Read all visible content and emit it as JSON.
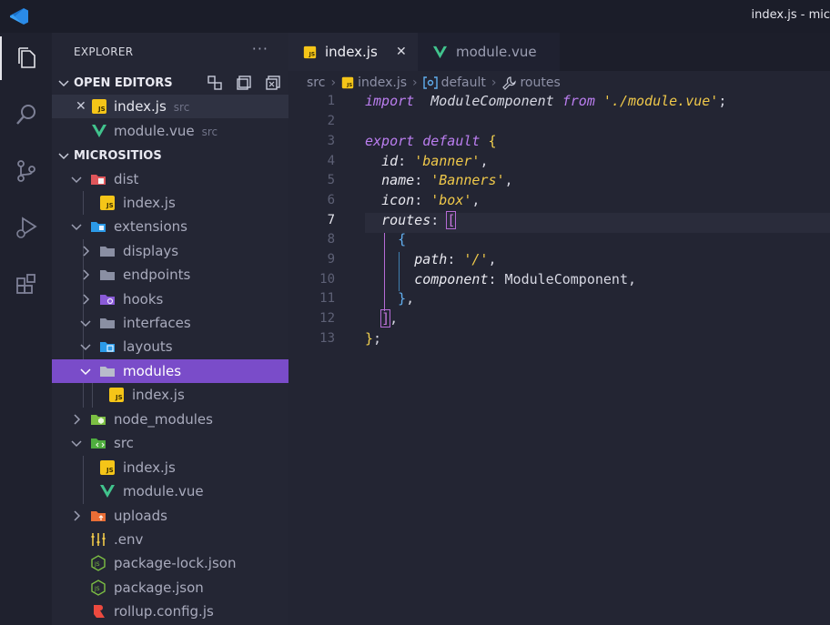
{
  "window": {
    "title": "index.js - mic"
  },
  "explorer": {
    "header": "EXPLORER",
    "more": "···",
    "open_editors": {
      "label": "OPEN EDITORS",
      "items": [
        {
          "name": "index.js",
          "desc": "src"
        },
        {
          "name": "module.vue",
          "desc": "src"
        }
      ]
    },
    "project": {
      "label": "MICROSITIOS",
      "tree": [
        "dist",
        "index.js",
        "extensions",
        "displays",
        "endpoints",
        "hooks",
        "interfaces",
        "layouts",
        "modules",
        "index.js",
        "node_modules",
        "src",
        "index.js",
        "module.vue",
        "uploads",
        ".env",
        "package-lock.json",
        "package.json",
        "rollup.config.js"
      ]
    }
  },
  "tabs": [
    {
      "label": "index.js",
      "close": "✕"
    },
    {
      "label": "module.vue"
    }
  ],
  "breadcrumb": [
    "src",
    "index.js",
    "default",
    "routes"
  ],
  "line_numbers": [
    "1",
    "2",
    "3",
    "4",
    "5",
    "6",
    "7",
    "8",
    "9",
    "10",
    "11",
    "12",
    "13"
  ],
  "current_line": "7",
  "code": {
    "l1_kw": "import",
    "l1_id": "ModuleComponent",
    "l1_from": "from",
    "l1_str": "'./module.vue'",
    "l3_kw1": "export",
    "l3_kw2": "default",
    "l4_key": "id",
    "l4_val": "'banner'",
    "l5_key": "name",
    "l5_val": "'Banners'",
    "l6_key": "icon",
    "l6_val": "'box'",
    "l7_key": "routes",
    "l9_key": "path",
    "l9_val": "'/'",
    "l10_key": "component",
    "l10_val": "ModuleComponent"
  },
  "colors": {
    "selection": "#7a4cc9",
    "keyword": "#bb7ef0",
    "string": "#f0c94a",
    "accent": "#23a7f2"
  }
}
